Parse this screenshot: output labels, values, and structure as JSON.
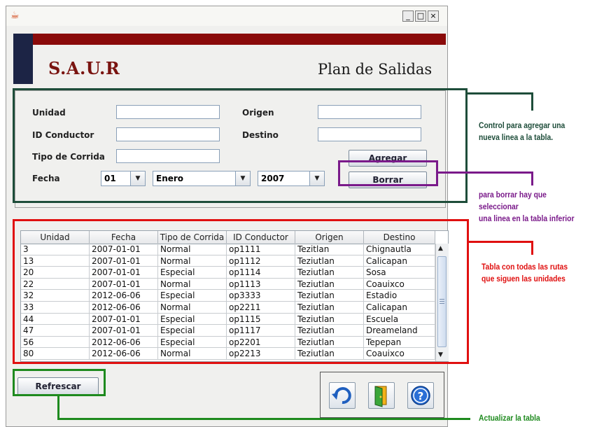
{
  "window": {
    "minimize": "_",
    "maximize": "□",
    "close": "×"
  },
  "header": {
    "brand": "S.A.U.R",
    "title": "Plan de Salidas"
  },
  "form": {
    "labels": {
      "unidad": "Unidad",
      "origen": "Origen",
      "id_conductor": "ID Conductor",
      "destino": "Destino",
      "tipo_corrida": "Tipo de Corrida",
      "fecha": "Fecha"
    },
    "values": {
      "unidad": "",
      "origen": "",
      "id_conductor": "",
      "destino": "",
      "tipo_corrida": ""
    },
    "day": "01",
    "month": "Enero",
    "year": "2007",
    "agregar_label": "Agregar",
    "borrar_label": "Borrar"
  },
  "table": {
    "columns": [
      "Unidad",
      "Fecha",
      "Tipo de Corrida",
      "ID Conductor",
      "Origen",
      "Destino"
    ],
    "rows": [
      [
        "3",
        "2007-01-01",
        "Normal",
        "op1111",
        "Tezitlan",
        "Chignautla"
      ],
      [
        "13",
        "2007-01-01",
        "Normal",
        "op1112",
        "Teziutlan",
        "Calicapan"
      ],
      [
        "20",
        "2007-01-01",
        "Especial",
        "op1114",
        "Teziutlan",
        "Sosa"
      ],
      [
        "22",
        "2007-01-01",
        "Normal",
        "op1113",
        "Teziutlan",
        "Coauixco"
      ],
      [
        "32",
        "2012-06-06",
        "Especial",
        "op3333",
        "Teziutlan",
        "Estadio"
      ],
      [
        "33",
        "2012-06-06",
        "Normal",
        "op2211",
        "Teziutlan",
        "Calicapan"
      ],
      [
        "44",
        "2007-01-01",
        "Especial",
        "op1115",
        "Teziutlan",
        "Escuela"
      ],
      [
        "47",
        "2007-01-01",
        "Especial",
        "op1117",
        "Teziutlan",
        "Dreameland"
      ],
      [
        "56",
        "2012-06-06",
        "Especial",
        "op2201",
        "Teziutlan",
        "Tepepan"
      ],
      [
        "80",
        "2012-06-06",
        "Normal",
        "op2213",
        "Teziutlan",
        "Coauixco"
      ]
    ]
  },
  "toolbar": {
    "refrescar_label": "Refrescar",
    "icons": [
      "undo-icon",
      "exit-door-icon",
      "help-icon"
    ]
  },
  "annotations": {
    "agregar_note_1": "Control para agregar una",
    "agregar_note_2": "nueva linea a la tabla.",
    "borrar_note_1": "para borrar hay que seleccionar",
    "borrar_note_2": "una linea en la tabla inferior",
    "tabla_note_1": "Tabla con todas las rutas",
    "tabla_note_2": "que siguen las unidades",
    "refrescar_note": "Actualizar la tabla"
  },
  "colors": {
    "annotation_green_dark": "#1e4d3a",
    "annotation_purple": "#7a1a8a",
    "annotation_red": "#e01010",
    "annotation_green": "#1e8a1e",
    "brand_red": "#8a0a0a",
    "brand_navy": "#1c2445"
  }
}
